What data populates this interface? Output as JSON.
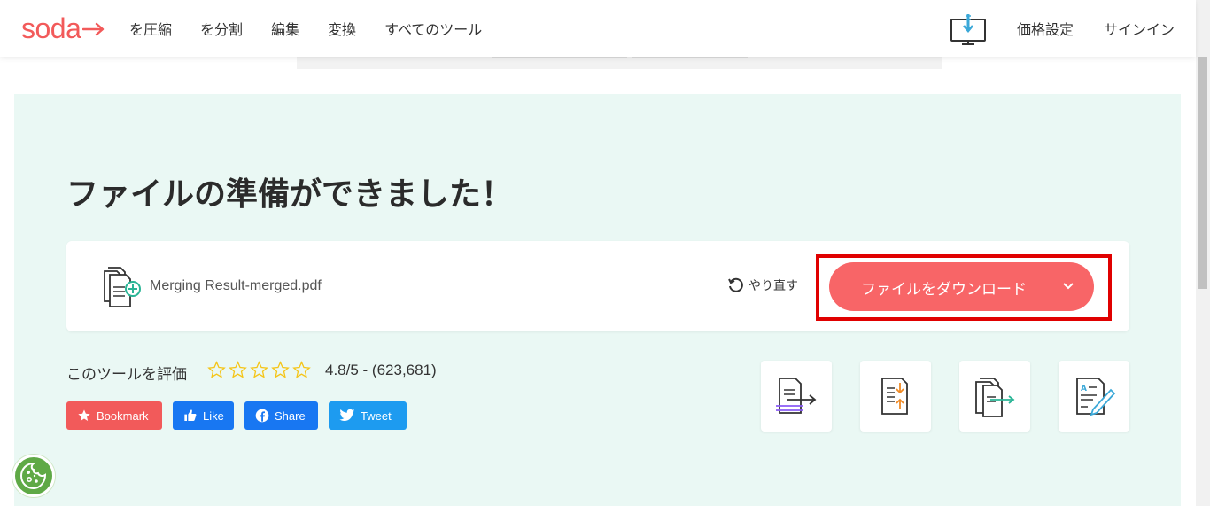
{
  "header": {
    "logo_text": "soda",
    "nav": [
      "を圧縮",
      "を分割",
      "編集",
      "変換",
      "すべてのツール"
    ],
    "pricing": "価格設定",
    "signin": "サインイン"
  },
  "main": {
    "title": "ファイルの準備ができました！",
    "file_name": "Merging Result-merged.pdf",
    "redo_label": "やり直す",
    "download_label": "ファイルをダウンロード",
    "rate_label": "このツールを評価",
    "rating": "4.8/5 - (623,681)",
    "stars_total": 5
  },
  "social": {
    "bookmark": "Bookmark",
    "like": "Like",
    "share": "Share",
    "tweet": "Tweet"
  },
  "colors": {
    "brand": "#f25a5a",
    "panel_bg": "#eaf8f4",
    "highlight": "#e00000",
    "facebook": "#1877f2",
    "twitter": "#1d9bf0"
  },
  "icons": {
    "desktop_download": "desktop-download-icon",
    "file": "merged-file-icon",
    "redo": "redo-icon",
    "chevron": "chevron-down-icon",
    "cookie": "cookie-icon"
  }
}
